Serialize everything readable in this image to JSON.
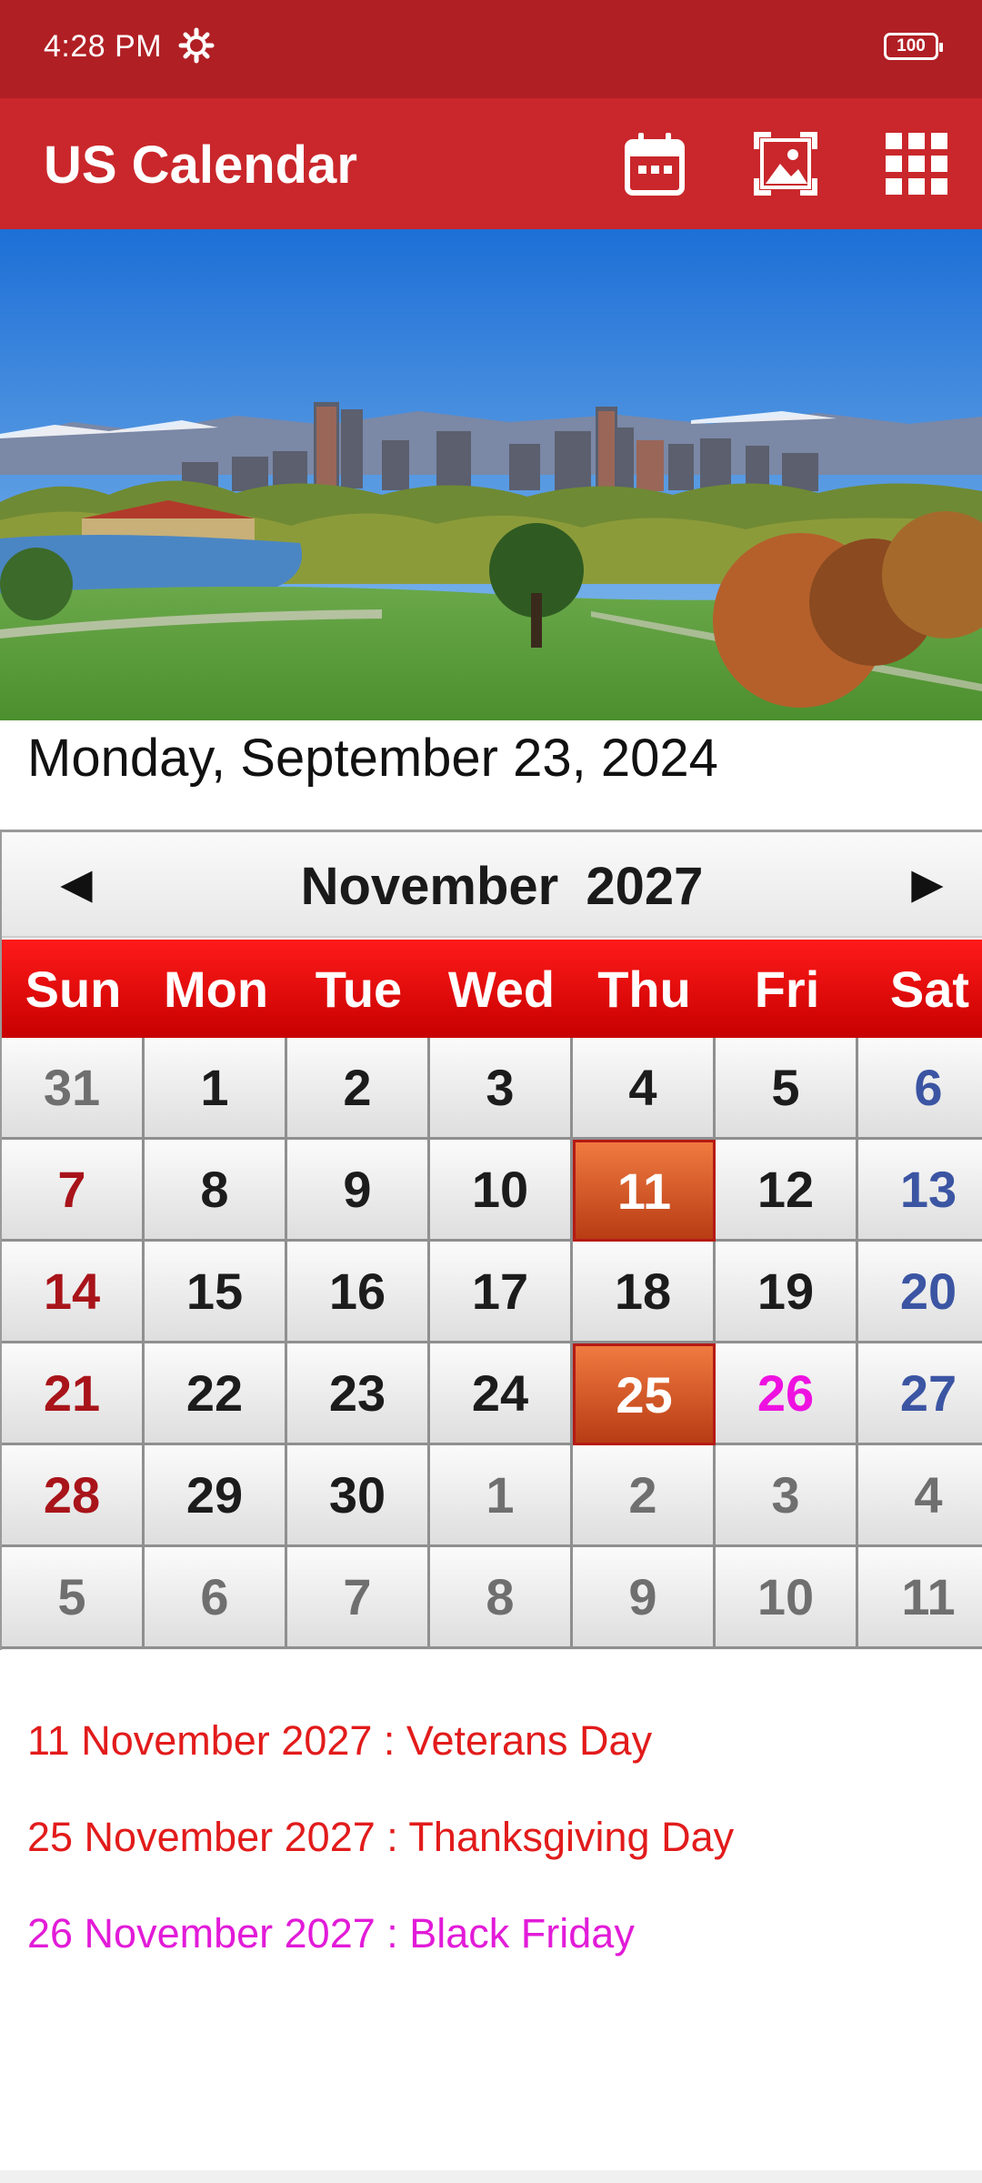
{
  "status": {
    "time": "4:28 PM",
    "battery": "100"
  },
  "app": {
    "title": "US Calendar",
    "icons": [
      "calendar-icon",
      "image-icon",
      "grid-menu-icon"
    ]
  },
  "current_date": "Monday, September 23, 2024",
  "calendar": {
    "prev": "◀",
    "next": "▶",
    "month_title": "November  2027",
    "weekdays": [
      "Sun",
      "Mon",
      "Tue",
      "Wed",
      "Thu",
      "Fri",
      "Sat"
    ],
    "weeks": [
      [
        "31",
        "1",
        "2",
        "3",
        "4",
        "5",
        "6"
      ],
      [
        "7",
        "8",
        "9",
        "10",
        "11",
        "12",
        "13"
      ],
      [
        "14",
        "15",
        "16",
        "17",
        "18",
        "19",
        "20"
      ],
      [
        "21",
        "22",
        "23",
        "24",
        "25",
        "26",
        "27"
      ],
      [
        "28",
        "29",
        "30",
        "1",
        "2",
        "3",
        "4"
      ],
      [
        "5",
        "6",
        "7",
        "8",
        "9",
        "10",
        "11"
      ]
    ],
    "other_month_first_row_count": 1,
    "other_month_start_row": 4,
    "other_month_start_col": 3,
    "highlighted_days": [
      "11",
      "25"
    ],
    "magenta_days": [
      "26"
    ]
  },
  "events": [
    {
      "text": "11 November 2027 : Veterans Day",
      "color": "#e21b1b"
    },
    {
      "text": "25 November 2027 : Thanksgiving Day",
      "color": "#e21b1b"
    },
    {
      "text": "26 November 2027 : Black Friday",
      "color": "#e21bd8"
    }
  ],
  "colors": {
    "status_bar": "#b01f24",
    "app_bar": "#c9272b",
    "weekday_header": "#e00000",
    "holiday_cell": "#d9531e",
    "sunday": "#a8141a",
    "saturday": "#3b55a3"
  }
}
